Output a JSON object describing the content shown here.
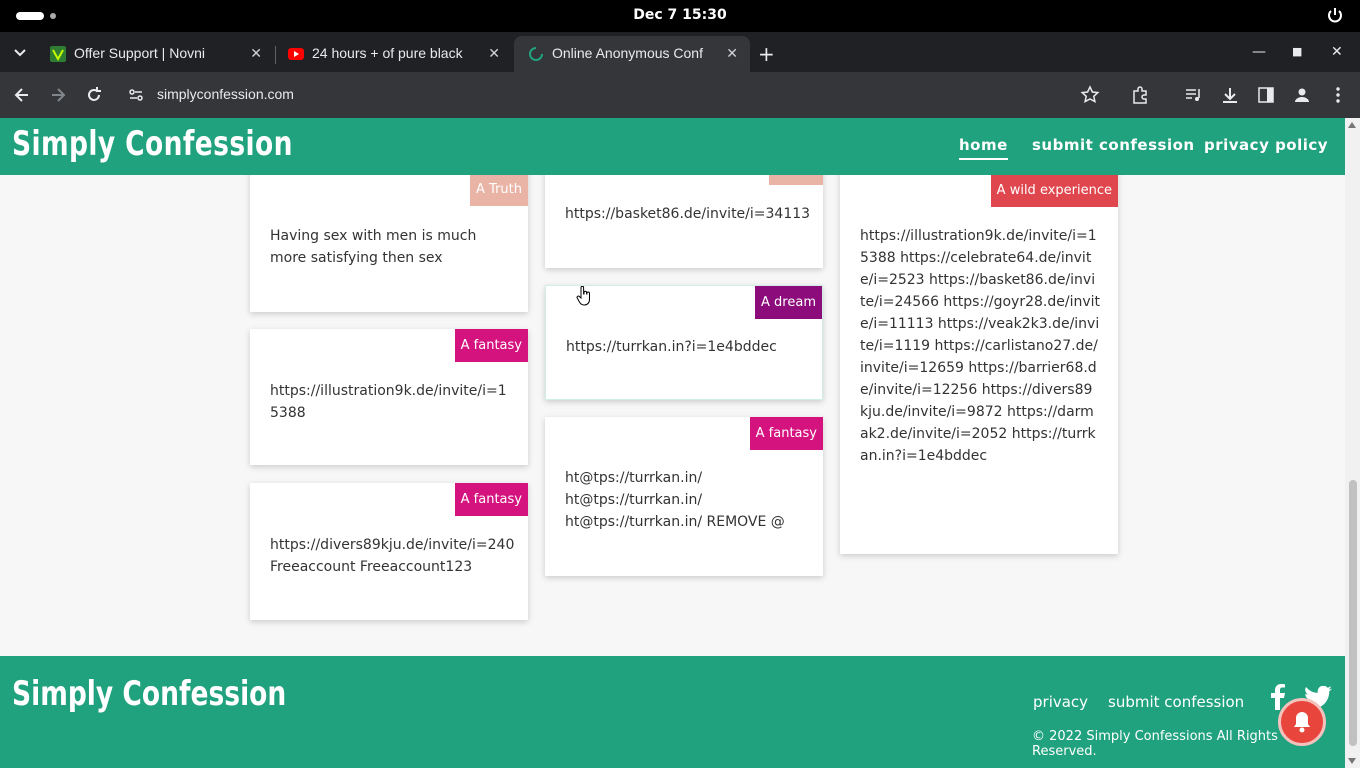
{
  "system": {
    "clock": "Dec 7  15:30"
  },
  "tabs": [
    {
      "title": "Offer Support | Novni",
      "favicon": "novni-icon"
    },
    {
      "title": "24 hours + of pure black",
      "favicon": "youtube-icon"
    },
    {
      "title": "Online Anonymous Conf",
      "favicon": "loading-icon"
    }
  ],
  "address": {
    "url": "simplyconfession.com"
  },
  "site": {
    "logo": "Simply Confession",
    "nav": [
      "home",
      "submit confession",
      "privacy policy"
    ]
  },
  "cards": {
    "c1": {
      "tag": "A Truth",
      "text": "Having sex with men is much more satisfying then sex"
    },
    "c2": {
      "tag": "A fantasy",
      "text": "https://illustration9k.de/invite/i=15388"
    },
    "c3": {
      "tag": "A fantasy",
      "text": "https://divers89kju.de/invite/i=240 Freeaccount Freeaccount123"
    },
    "c4": {
      "tag": "",
      "text": "https://basket86.de/invite/i=34113"
    },
    "c5": {
      "tag": "A dream",
      "text": "https://turrkan.in?i=1e4bddec"
    },
    "c6": {
      "tag": "A fantasy",
      "lines": [
        "ht@tps://turrkan.in/",
        "ht@tps://turrkan.in/",
        "ht@tps://turrkan.in/ REMOVE @"
      ]
    },
    "c7": {
      "tag": "A wild experience",
      "text": "https://illustration9k.de/invite/i=15388 https://celebrate64.de/invite/i=2523 https://basket86.de/invite/i=24566 https://goyr28.de/invite/i=11113 https://veak2k3.de/invite/i=1119 https://carlistano27.de/invite/i=12659 https://barrier68.de/invite/i=12256 https://divers89kju.de/invite/i=9872 https://darmak2.de/invite/i=2052 https://turrkan.in?i=1e4bddec"
    }
  },
  "footer": {
    "logo": "Simply Confession",
    "links": [
      "privacy",
      "submit confession"
    ],
    "copyright": "© 2022 Simply Confessions All Rights Reserved."
  },
  "colors": {
    "brand": "#20a27e",
    "truth": "#e9b3a6",
    "fantasy": "#d5137f",
    "dream": "#8b0c7a",
    "wild": "#e0464d"
  }
}
